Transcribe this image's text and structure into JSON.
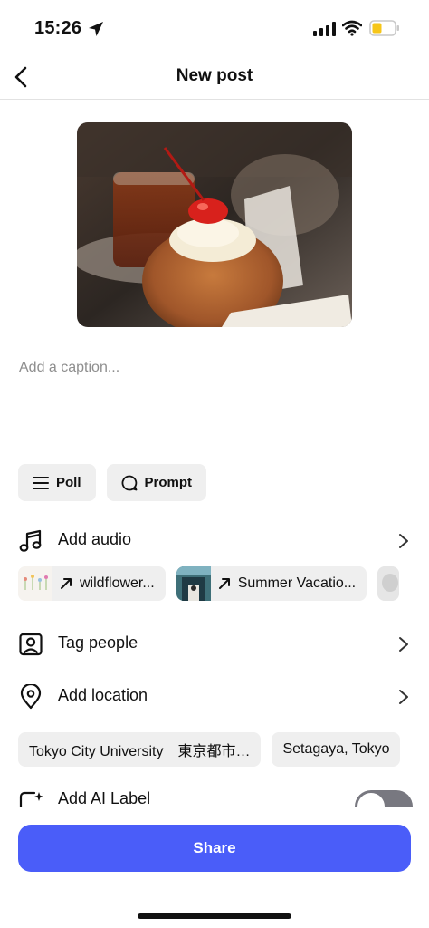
{
  "status_bar": {
    "time": "15:26"
  },
  "header": {
    "title": "New post"
  },
  "caption": {
    "placeholder": "Add a caption..."
  },
  "chips": [
    {
      "label": "Poll",
      "icon": "list-icon"
    },
    {
      "label": "Prompt",
      "icon": "speech-bubble-icon"
    }
  ],
  "audio": {
    "label": "Add audio",
    "suggestions": [
      {
        "label": "wildflower..."
      },
      {
        "label": "Summer Vacatio..."
      }
    ]
  },
  "tag_people": {
    "label": "Tag people"
  },
  "location": {
    "label": "Add location",
    "suggestions": [
      {
        "label": "Tokyo City University　東京都市…"
      },
      {
        "label": "Setagaya, Tokyo"
      }
    ]
  },
  "ai_label": {
    "label": "Add AI Label",
    "enabled": false
  },
  "share": {
    "label": "Share"
  },
  "colors": {
    "accent": "#4a5df9",
    "chip_bg": "#efefef",
    "toggle_off": "#787880"
  }
}
